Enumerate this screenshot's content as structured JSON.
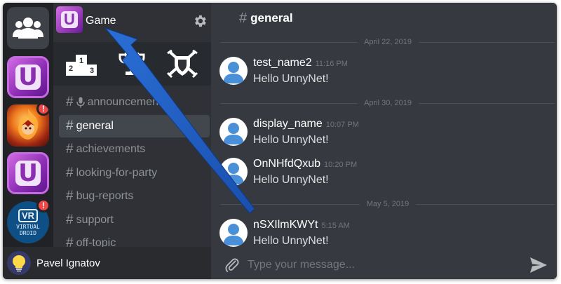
{
  "colors": {
    "rail_bg": "#202225",
    "channels_bg": "#2f3136",
    "chat_bg": "#36393f",
    "accent_purple": "#8e2fb6",
    "badge_red": "#f04747",
    "annotation_arrow": "#1e5bbf"
  },
  "rail": {
    "home_icon": "users-group-icon",
    "servers": [
      {
        "name": "unnynet-server",
        "glyph": "U",
        "badge": ""
      },
      {
        "name": "fire-hero-server",
        "glyph": "",
        "badge": "!"
      },
      {
        "name": "unnynet-server-2",
        "glyph": "U",
        "badge": ""
      },
      {
        "name": "virtual-droid-server",
        "vr_label": "VR",
        "caption_1": "VIRTUAL",
        "caption_2": "DROID",
        "badge": "!"
      }
    ]
  },
  "guild": {
    "name": "Game",
    "icon_glyph": "U",
    "settings_icon": "gear-icon"
  },
  "quick_actions": [
    {
      "name": "leaderboard-icon"
    },
    {
      "name": "trophy-icon"
    },
    {
      "name": "shield-swords-icon"
    }
  ],
  "channels": [
    {
      "label": "announcements",
      "has_mic": true,
      "active": false
    },
    {
      "label": "general",
      "has_mic": false,
      "active": true
    },
    {
      "label": "achievements",
      "has_mic": false,
      "active": false
    },
    {
      "label": "looking-for-party",
      "has_mic": false,
      "active": false
    },
    {
      "label": "bug-reports",
      "has_mic": false,
      "active": false
    },
    {
      "label": "support",
      "has_mic": false,
      "active": false
    },
    {
      "label": "off-topic",
      "has_mic": false,
      "active": false
    }
  ],
  "user": {
    "name": "Pavel Ignatov",
    "avatar_icon": "lightbulb-icon"
  },
  "chat": {
    "channel_title": "general",
    "dividers": [
      "April 22, 2019",
      "April 30, 2019",
      "May 5, 2019"
    ],
    "messages": [
      {
        "author": "test_name2",
        "time": "11:16 PM",
        "text": "Hello UnnyNet!"
      },
      {
        "author": "display_name",
        "time": "10:07 PM",
        "text": "Hello UnnyNet!"
      },
      {
        "author": "OnNHfdQxub",
        "time": "10:20 PM",
        "text": "Hello UnnyNet!"
      },
      {
        "author": "nSXIlmKWYt",
        "time": "5:15 AM",
        "text": "Hello UnnyNet!"
      }
    ],
    "composer_placeholder": "Type your message...",
    "attach_icon": "paperclip-icon",
    "send_icon": "send-icon"
  }
}
